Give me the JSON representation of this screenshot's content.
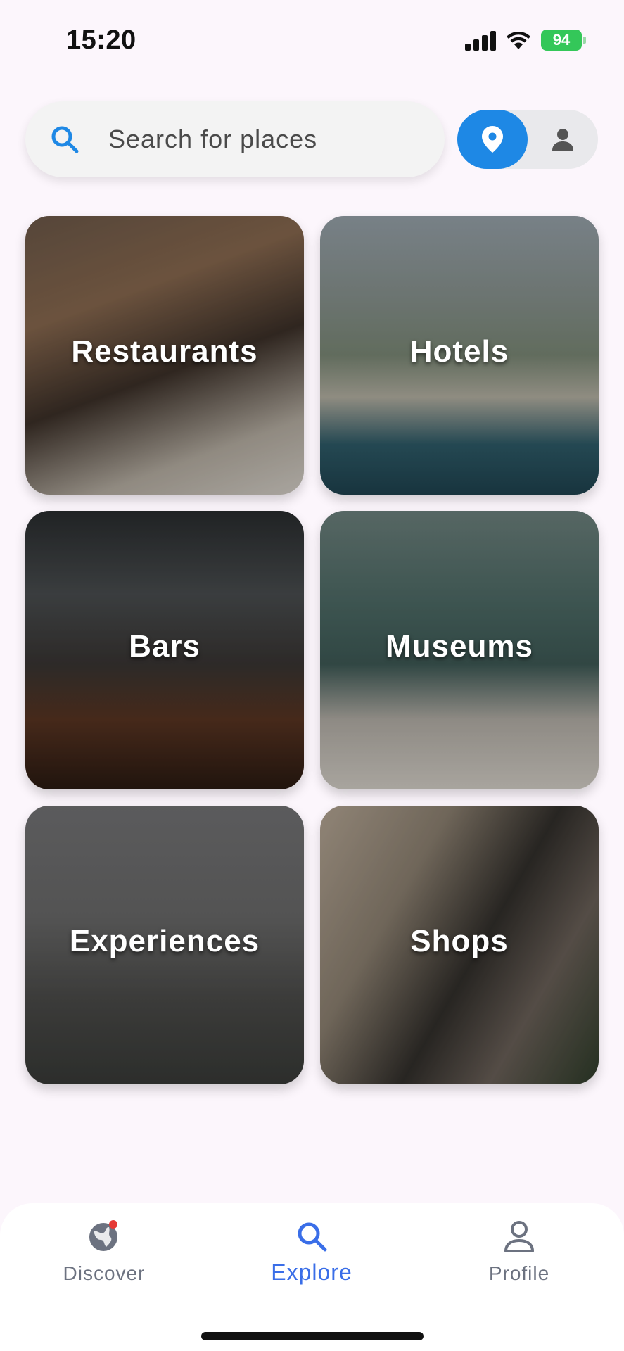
{
  "status_bar": {
    "time": "15:20",
    "battery": "94"
  },
  "search": {
    "placeholder": "Search for places",
    "value": ""
  },
  "view_toggle": {
    "active": "map"
  },
  "categories": [
    {
      "label": "Restaurants"
    },
    {
      "label": "Hotels"
    },
    {
      "label": "Bars"
    },
    {
      "label": "Museums"
    },
    {
      "label": "Experiences"
    },
    {
      "label": "Shops"
    }
  ],
  "nav": {
    "items": [
      {
        "label": "Discover",
        "icon": "globe-icon",
        "active": false
      },
      {
        "label": "Explore",
        "icon": "search-icon",
        "active": true
      },
      {
        "label": "Profile",
        "icon": "person-icon",
        "active": false
      }
    ]
  },
  "colors": {
    "accent": "#1e88e5",
    "active_nav": "#3a6ee8",
    "background": "#fcf6fc"
  }
}
